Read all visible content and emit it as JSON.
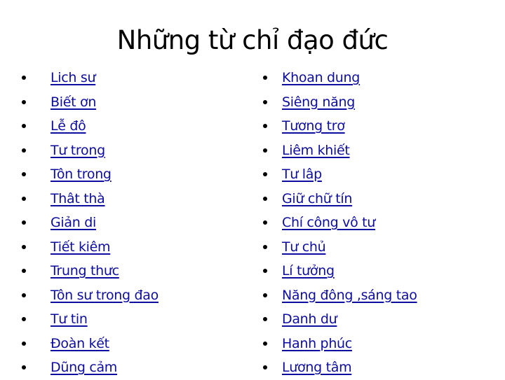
{
  "slide": {
    "title": "Những từ chỉ đạo đức",
    "link_color": "#0d0da0",
    "left_column": [
      "Lich sư",
      "Biết ơn",
      "Lễ đô",
      "Tư trong",
      "Tôn trong",
      "Thât thà",
      "Giản di",
      "Tiết kiêm",
      "Trung thưc",
      "Tôn sư trong đao",
      "Tư tin",
      "Đoàn kết",
      "Dũng cảm"
    ],
    "right_column": [
      "Khoan dung",
      "Siêng năng",
      "Tương trơ",
      "Liêm khiết",
      "Tư lâp",
      "Giữ chữ tín",
      "Chí công vô tư",
      "Tư chủ",
      "Lí tưởng",
      "Năng đông ,sáng tao",
      "Danh dư",
      "Hanh phúc",
      "Lương tâm"
    ]
  }
}
